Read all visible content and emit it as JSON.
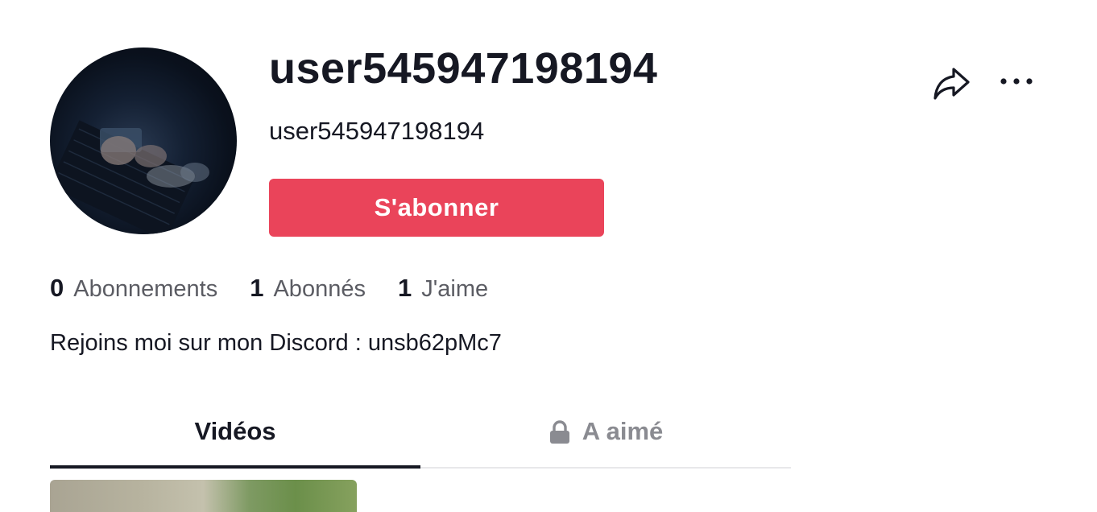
{
  "profile": {
    "display_name": "user545947198194",
    "username": "user545947198194",
    "avatar_icon": "profile-photo",
    "follow_label": "S'abonner",
    "bio": "Rejoins moi sur mon Discord : unsb62pMc7"
  },
  "stats": [
    {
      "value": "0",
      "label": "Abonnements"
    },
    {
      "value": "1",
      "label": "Abonnés"
    },
    {
      "value": "1",
      "label": "J'aime"
    }
  ],
  "actions": {
    "share_icon": "share-arrow-icon",
    "more_icon": "more-dots-icon"
  },
  "tabs": [
    {
      "label": "Vidéos",
      "active": true
    },
    {
      "label": "A aimé",
      "locked": true,
      "icon": "lock-icon"
    }
  ],
  "colors": {
    "accent": "#ea445a",
    "text_primary": "#161823",
    "text_secondary": "#5b5c63",
    "text_muted": "#8a8b91"
  }
}
